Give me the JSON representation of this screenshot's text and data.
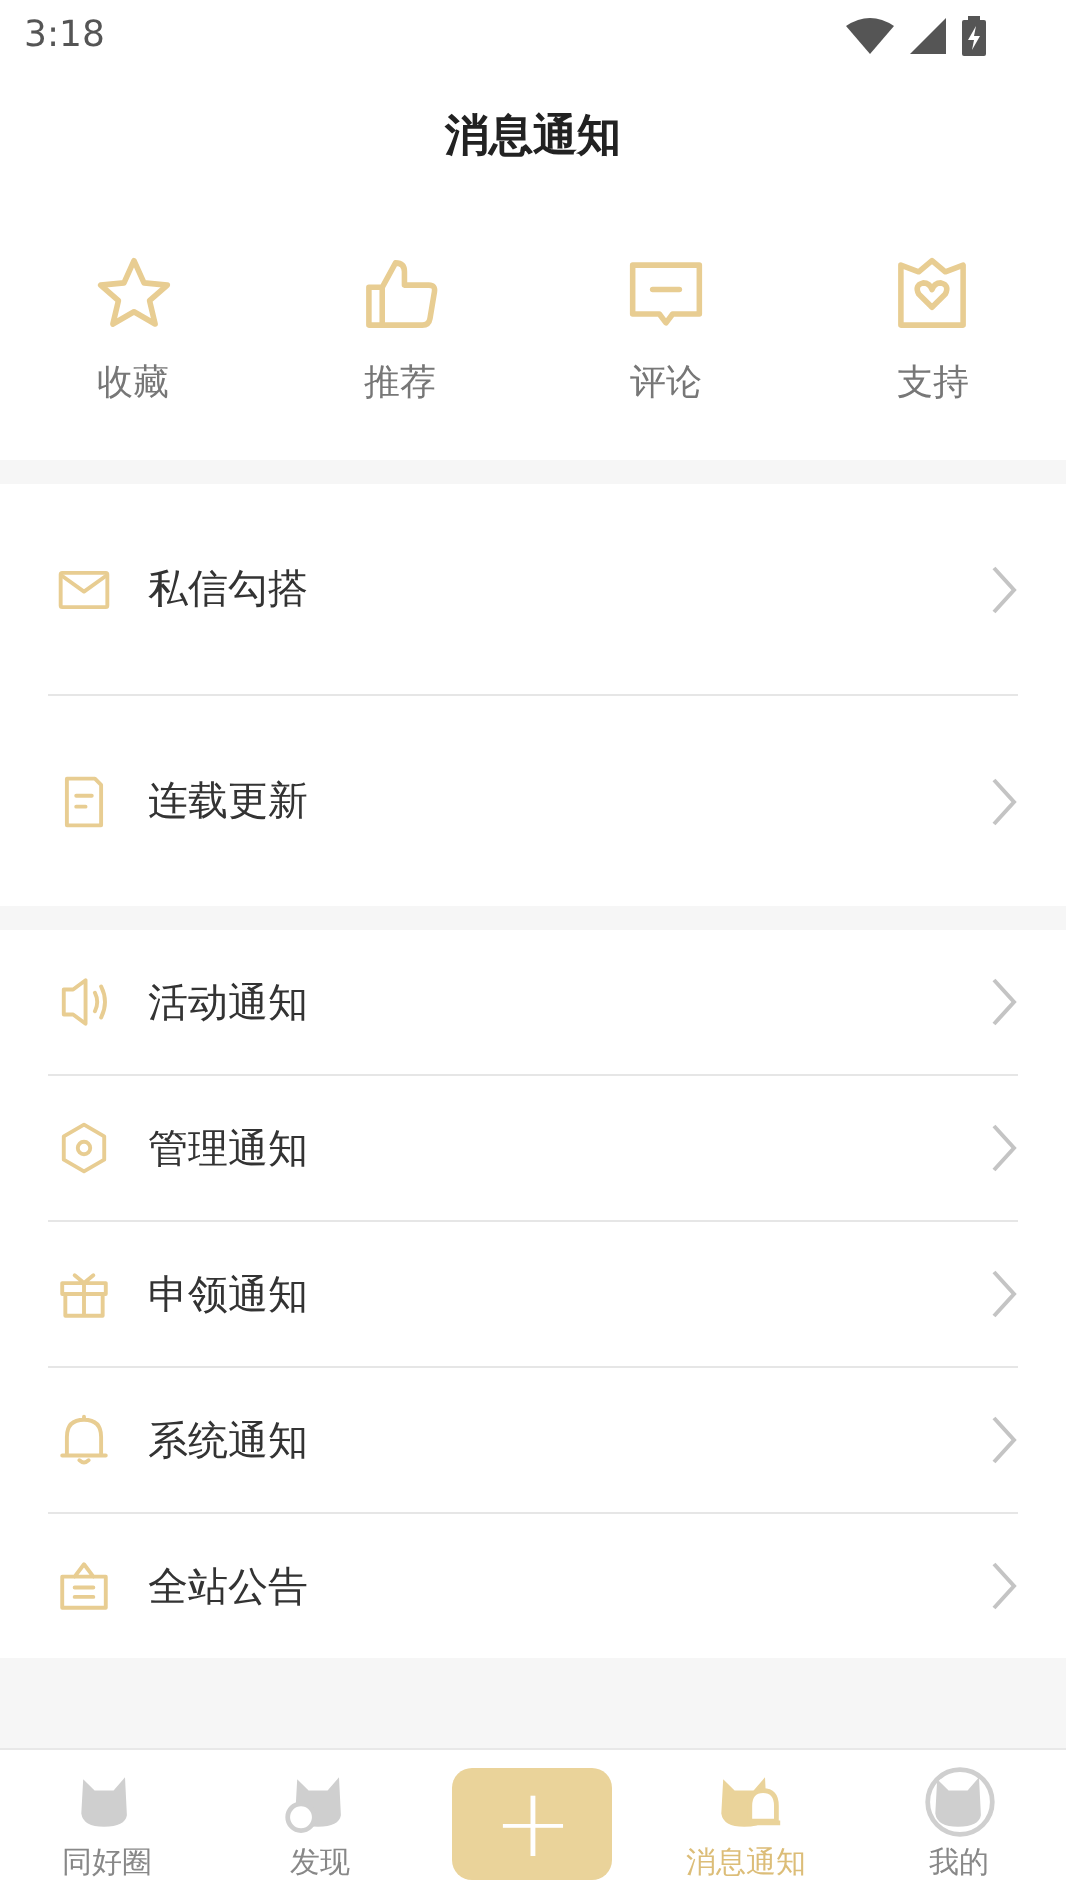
{
  "status_bar": {
    "time": "3:18"
  },
  "header": {
    "title": "消息通知"
  },
  "quick_actions": [
    {
      "label": "收藏"
    },
    {
      "label": "推荐"
    },
    {
      "label": "评论"
    },
    {
      "label": "支持"
    }
  ],
  "groups": [
    {
      "items": [
        {
          "label": "私信勾搭"
        },
        {
          "label": "连载更新"
        }
      ]
    },
    {
      "items": [
        {
          "label": "活动通知"
        },
        {
          "label": "管理通知"
        },
        {
          "label": "申领通知"
        },
        {
          "label": "系统通知"
        },
        {
          "label": "全站公告"
        }
      ]
    }
  ],
  "tabs": [
    {
      "kind": "tab",
      "label": "同好圈",
      "selected": false
    },
    {
      "kind": "tab",
      "label": "发现",
      "selected": false
    },
    {
      "kind": "add",
      "label": "+"
    },
    {
      "kind": "tab",
      "label": "消息通知",
      "selected": true
    },
    {
      "kind": "tab",
      "label": "我的",
      "selected": false
    }
  ]
}
